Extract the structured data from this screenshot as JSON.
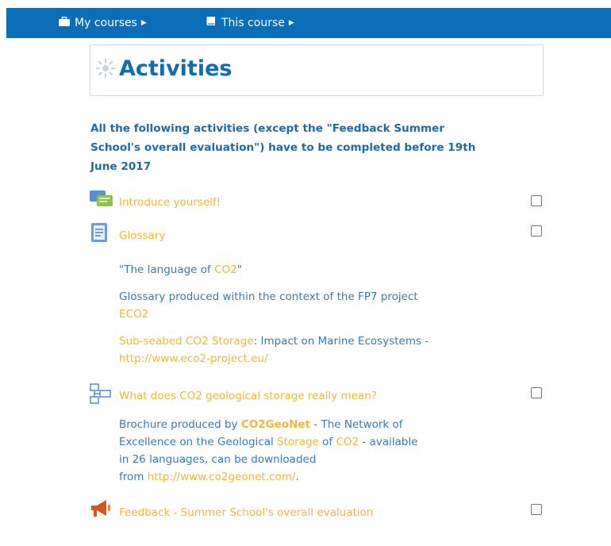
{
  "nav": {
    "my_courses": "My courses",
    "this_course": "This course"
  },
  "page": {
    "title": "Activities",
    "notice": "All the following activities (except the \"Feedback Summer School's overall evaluation\") have to be completed before 19th June 2017"
  },
  "activities": [
    {
      "label": "Introduce yourself!",
      "icon": "forum-icon",
      "completed": false
    },
    {
      "label": "Glossary",
      "icon": "glossary-icon",
      "completed": false
    },
    {
      "label": "What does CO2 geological storage really mean?",
      "icon": "folder-icon",
      "completed": false
    },
    {
      "label": "Feedback - Summer School's overall evaluation",
      "icon": "megaphone-icon",
      "completed": false
    }
  ],
  "glossary_desc": {
    "line1_a": "\"The language of ",
    "line1_link": "CO2",
    "line1_b": "\"",
    "line2": "Glossary produced within the context of the FP7 project",
    "line3_link": "ECO2",
    "line4_link": "Sub-seabed CO2 Storage",
    "line4_b": ": Impact on Marine Ecosystems -",
    "line5_link": "http://www.eco2-project.eu/"
  },
  "brochure_desc": {
    "line1_a": "Brochure produced by ",
    "line1_bold": "CO2GeoNet",
    "line1_b": " - The Network of",
    "line2_a": "Excellence on the Geological ",
    "line2_link1": "Storage",
    "line2_b": " of ",
    "line2_link2": "CO2",
    "line2_c": " - available",
    "line3": "in 26 languages, can be downloaded",
    "line4_a": "from ",
    "line4_link": "http://www.co2geonet.com/",
    "line4_b": "."
  },
  "colors": {
    "navbar": "#0a6fb8",
    "title": "#0f6cae",
    "link": "#f5b433",
    "text": "#3579b5"
  }
}
